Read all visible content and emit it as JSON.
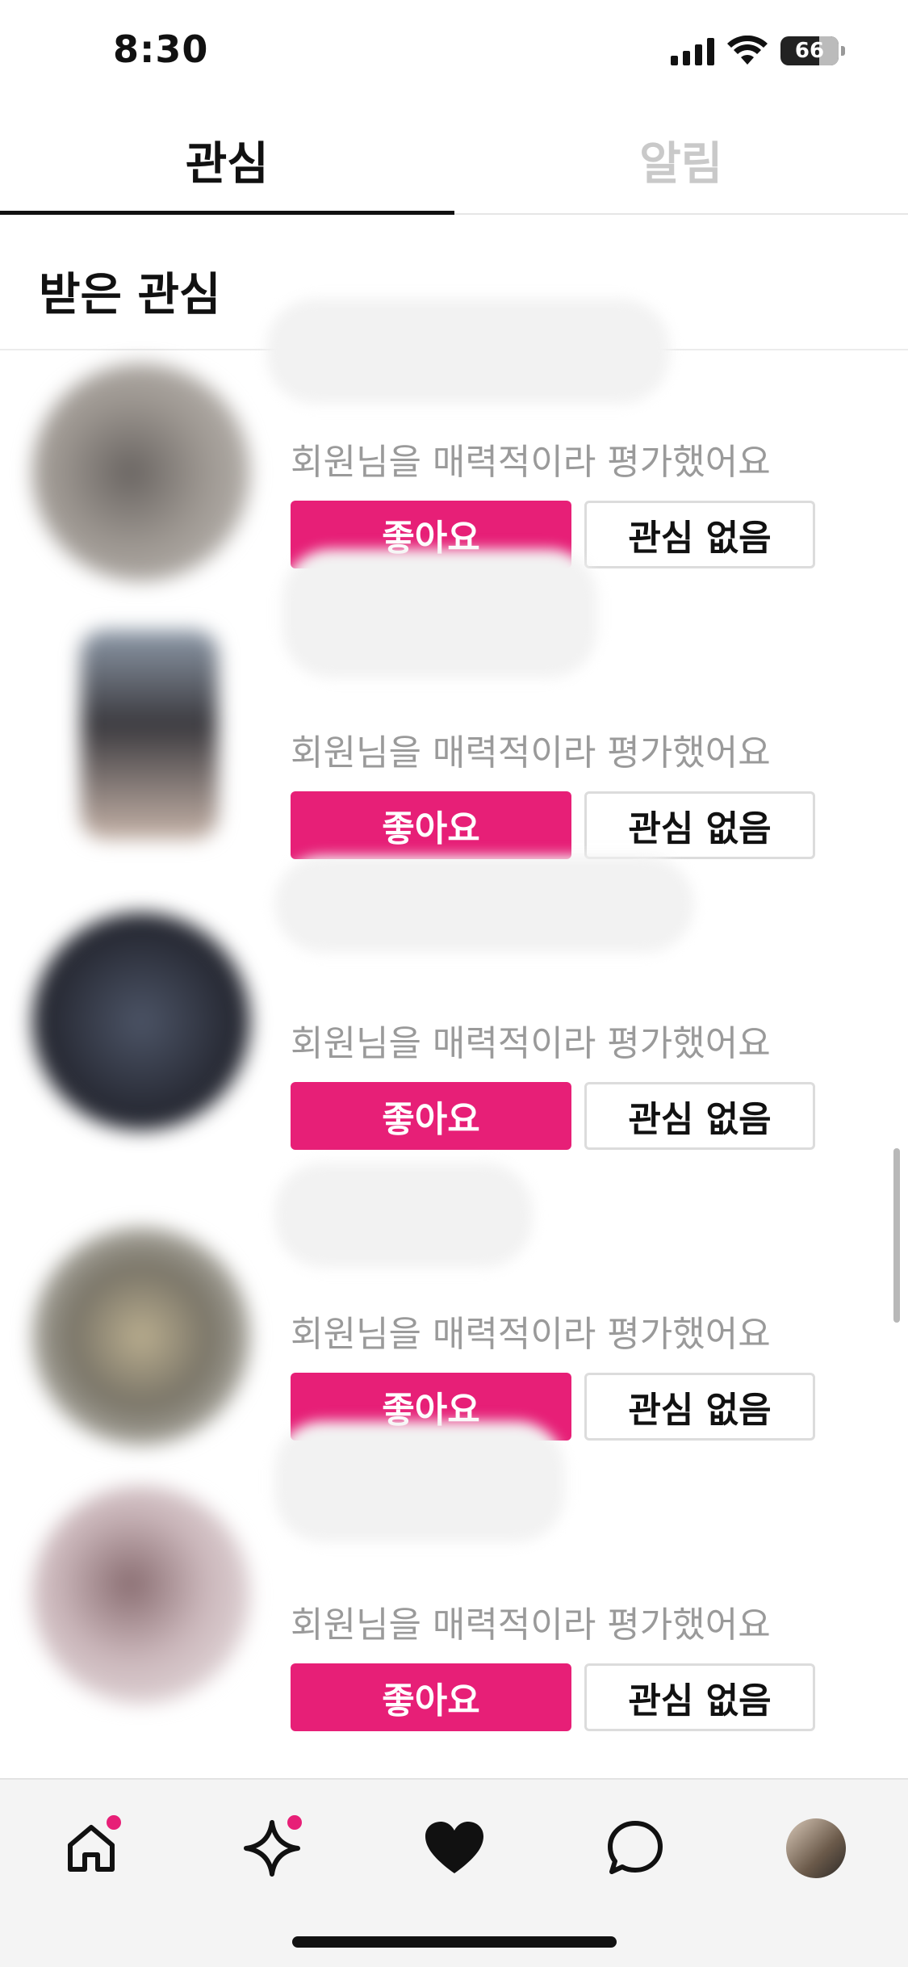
{
  "status_bar": {
    "time": "8:30",
    "battery": "66"
  },
  "tabs": [
    {
      "label": "관심",
      "active": true
    },
    {
      "label": "알림",
      "active": false
    }
  ],
  "section": {
    "title": "받은 관심"
  },
  "items": [
    {
      "name": "",
      "description": "회원님을 매력적이라 평가했어요",
      "like_label": "좋아요",
      "dislike_label": "관심 없음"
    },
    {
      "name": "",
      "description": "회원님을 매력적이라 평가했어요",
      "like_label": "좋아요",
      "dislike_label": "관심 없음"
    },
    {
      "name": "",
      "description": "회원님을 매력적이라 평가했어요",
      "like_label": "좋아요",
      "dislike_label": "관심 없음"
    },
    {
      "name": "",
      "description": "회원님을 매력적이라 평가했어요",
      "like_label": "좋아요",
      "dislike_label": "관심 없음"
    },
    {
      "name": "",
      "description": "회원님을 매력적이라 평가했어요",
      "like_label": "좋아요",
      "dislike_label": "관심 없음"
    }
  ],
  "bottom_nav": [
    {
      "icon": "home-icon",
      "badge": true
    },
    {
      "icon": "sparkle-icon",
      "badge": true
    },
    {
      "icon": "heart-icon",
      "badge": false
    },
    {
      "icon": "chat-bubble-icon",
      "badge": false
    },
    {
      "icon": "profile-avatar",
      "badge": false
    }
  ],
  "colors": {
    "accent": "#e71f77",
    "inactive_tab": "#c9c9c9",
    "description": "#9a9a9a"
  }
}
